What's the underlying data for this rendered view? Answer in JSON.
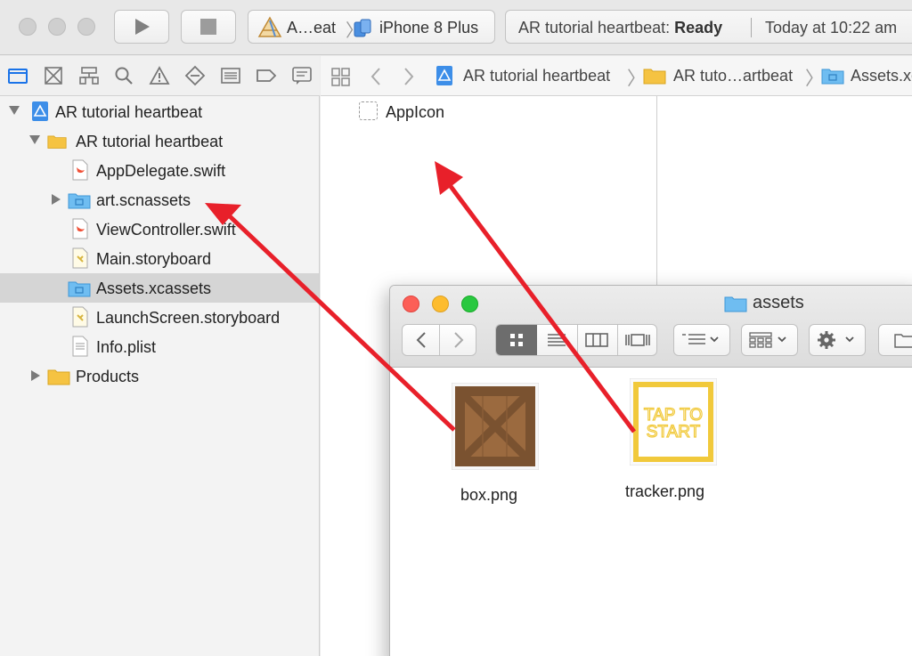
{
  "toolbar": {
    "run_label": "Run",
    "stop_label": "Stop",
    "scheme_name": "A…eat",
    "scheme_separator": "〉",
    "device_name": "iPhone 8 Plus",
    "status_project": "AR tutorial heartbeat:",
    "status_state": "Ready",
    "status_time": "Today at 10:22 am"
  },
  "navigator": {
    "tab_icons": [
      "folder-icon",
      "source-control-icon",
      "hierarchy-icon",
      "search-icon",
      "warning-icon",
      "test-icon",
      "debug-icon",
      "breakpoint-icon",
      "report-icon"
    ],
    "items": [
      {
        "label": "AR tutorial heartbeat",
        "kind": "project",
        "icon": "xcode-project-icon",
        "disclosure": "down"
      },
      {
        "label": "AR tutorial heartbeat",
        "kind": "group",
        "icon": "folder-icon",
        "disclosure": "down"
      },
      {
        "label": "AppDelegate.swift",
        "kind": "file",
        "icon": "swift-file-icon"
      },
      {
        "label": "art.scnassets",
        "kind": "folder",
        "icon": "blue-folder-icon",
        "disclosure": "right"
      },
      {
        "label": "ViewController.swift",
        "kind": "file",
        "icon": "swift-file-icon"
      },
      {
        "label": "Main.storyboard",
        "kind": "file",
        "icon": "storyboard-file-icon"
      },
      {
        "label": "Assets.xcassets",
        "kind": "folder",
        "icon": "blue-folder-icon",
        "selected": true
      },
      {
        "label": "LaunchScreen.storyboard",
        "kind": "file",
        "icon": "storyboard-file-icon"
      },
      {
        "label": "Info.plist",
        "kind": "file",
        "icon": "plist-file-icon"
      },
      {
        "label": "Products",
        "kind": "group",
        "icon": "folder-icon",
        "disclosure": "right"
      }
    ]
  },
  "jumpbar": {
    "crumbs": [
      "AR tutorial heartbeat",
      "AR tuto…artbeat",
      "Assets.xca"
    ]
  },
  "editor": {
    "asset_name": "AppIcon"
  },
  "finder": {
    "title": "assets",
    "files": [
      {
        "name": "box.png",
        "thumb": "wooden-crate-image"
      },
      {
        "name": "tracker.png",
        "thumb": "tap-to-start-image",
        "thumb_text_1": "TAP TO",
        "thumb_text_2": "START"
      }
    ]
  },
  "colors": {
    "arrow": "#e8202a",
    "selection": "#d5d5d5",
    "finder_close": "#fc5f57",
    "finder_minimize": "#fdbc2e",
    "finder_zoom": "#29c840",
    "tracker_yellow": "#f1c93b"
  }
}
